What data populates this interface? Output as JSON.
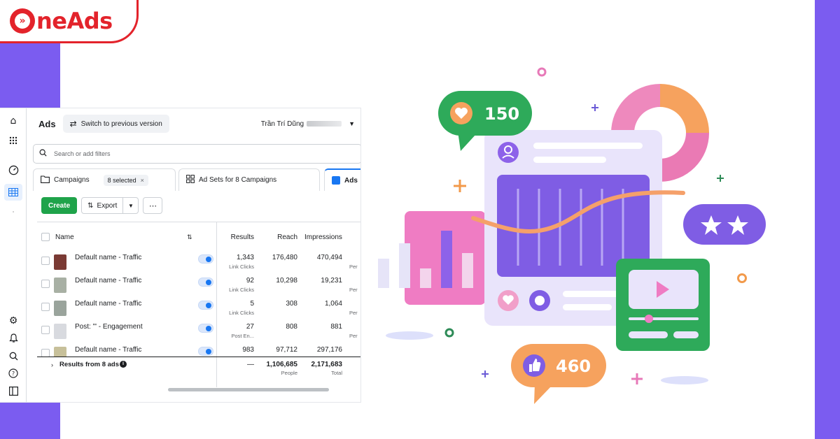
{
  "brand": {
    "logo_text": "neAds",
    "logo_glyph": "O",
    "accent": "#e3232b",
    "band_color": "#7b5cf0"
  },
  "rail": {
    "icons": [
      "home-icon",
      "apps-grid-icon",
      "gauge-icon",
      "table-icon",
      "settings-icon",
      "bell-icon",
      "search-icon",
      "help-icon",
      "panel-icon"
    ]
  },
  "header": {
    "title": "Ads",
    "switch_label": "Switch to previous version",
    "account_name": "Trần Trí Dũng"
  },
  "search": {
    "placeholder": "Search or add filters"
  },
  "tabs": {
    "campaigns_label": "Campaigns",
    "selected_chip": "8 selected",
    "adsets_label": "Ad Sets for 8 Campaigns",
    "ads_label": "Ads"
  },
  "toolbar": {
    "create_label": "Create",
    "export_label": "Export",
    "more_label": "⋯"
  },
  "table": {
    "headers": {
      "name": "Name",
      "results": "Results",
      "reach": "Reach",
      "impressions": "Impressions"
    },
    "rows": [
      {
        "name": "Default name - Traffic",
        "results": "1,343",
        "results_sub": "Link Clicks",
        "reach": "176,480",
        "impressions": "470,494",
        "edge_sub": "Per",
        "thumb": "#7a3a34"
      },
      {
        "name": "Default name - Traffic",
        "results": "92",
        "results_sub": "Link Clicks",
        "reach": "10,298",
        "impressions": "19,231",
        "edge_sub": "Per",
        "thumb": "#a8b0a4"
      },
      {
        "name": "Default name - Traffic",
        "results": "5",
        "results_sub": "Link Clicks",
        "reach": "308",
        "impressions": "1,064",
        "edge_sub": "Per",
        "thumb": "#9aa49c"
      },
      {
        "name": "Post: \"' - Engagement",
        "results": "27",
        "results_sub": "Post En...",
        "reach": "808",
        "impressions": "881",
        "edge_sub": "Per",
        "thumb": "#d8dadf"
      },
      {
        "name": "Default name - Traffic",
        "results": "983",
        "results_sub": "",
        "reach": "97,712",
        "impressions": "297,176",
        "edge_sub": "",
        "thumb": "#c7c09a"
      }
    ],
    "summary": {
      "label": "Results from 8 ads",
      "results": "—",
      "reach": "1,106,685",
      "reach_sub": "People",
      "impressions": "2,171,683",
      "impressions_sub": "Total"
    }
  },
  "illustration": {
    "likes_count": "150",
    "thumbs_count": "460",
    "rating_stars": 2
  }
}
